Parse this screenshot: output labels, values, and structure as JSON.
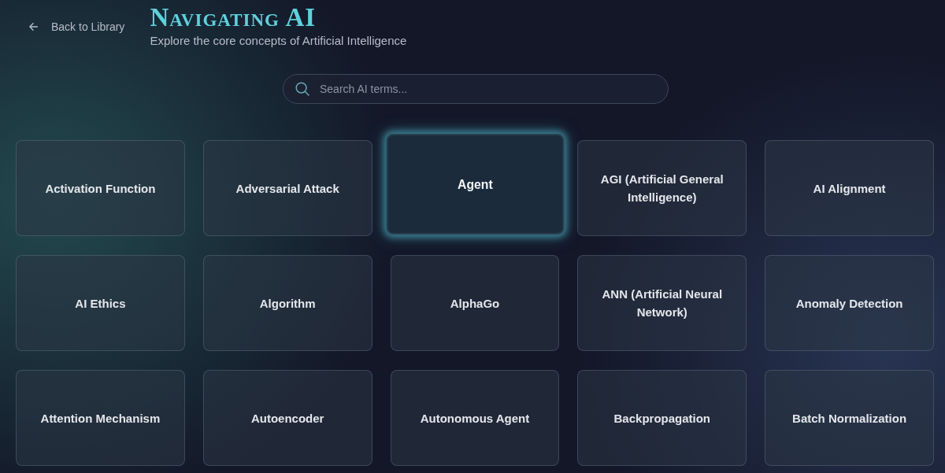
{
  "back_link": {
    "label": "Back to Library"
  },
  "header": {
    "title": "Navigating AI",
    "subtitle": "Explore the core concepts of Artificial Intelligence"
  },
  "search": {
    "placeholder": "Search AI terms..."
  },
  "terms": [
    {
      "label": "Activation Function",
      "selected": false
    },
    {
      "label": "Adversarial Attack",
      "selected": false
    },
    {
      "label": "Agent",
      "selected": true
    },
    {
      "label": "AGI (Artificial General Intelligence)",
      "selected": false
    },
    {
      "label": "AI Alignment",
      "selected": false
    },
    {
      "label": "AI Ethics",
      "selected": false
    },
    {
      "label": "Algorithm",
      "selected": false
    },
    {
      "label": "AlphaGo",
      "selected": false
    },
    {
      "label": "ANN (Artificial Neural Network)",
      "selected": false
    },
    {
      "label": "Anomaly Detection",
      "selected": false
    },
    {
      "label": "Attention Mechanism",
      "selected": false
    },
    {
      "label": "Autoencoder",
      "selected": false
    },
    {
      "label": "Autonomous Agent",
      "selected": false
    },
    {
      "label": "Backpropagation",
      "selected": false
    },
    {
      "label": "Batch Normalization",
      "selected": false
    }
  ]
}
